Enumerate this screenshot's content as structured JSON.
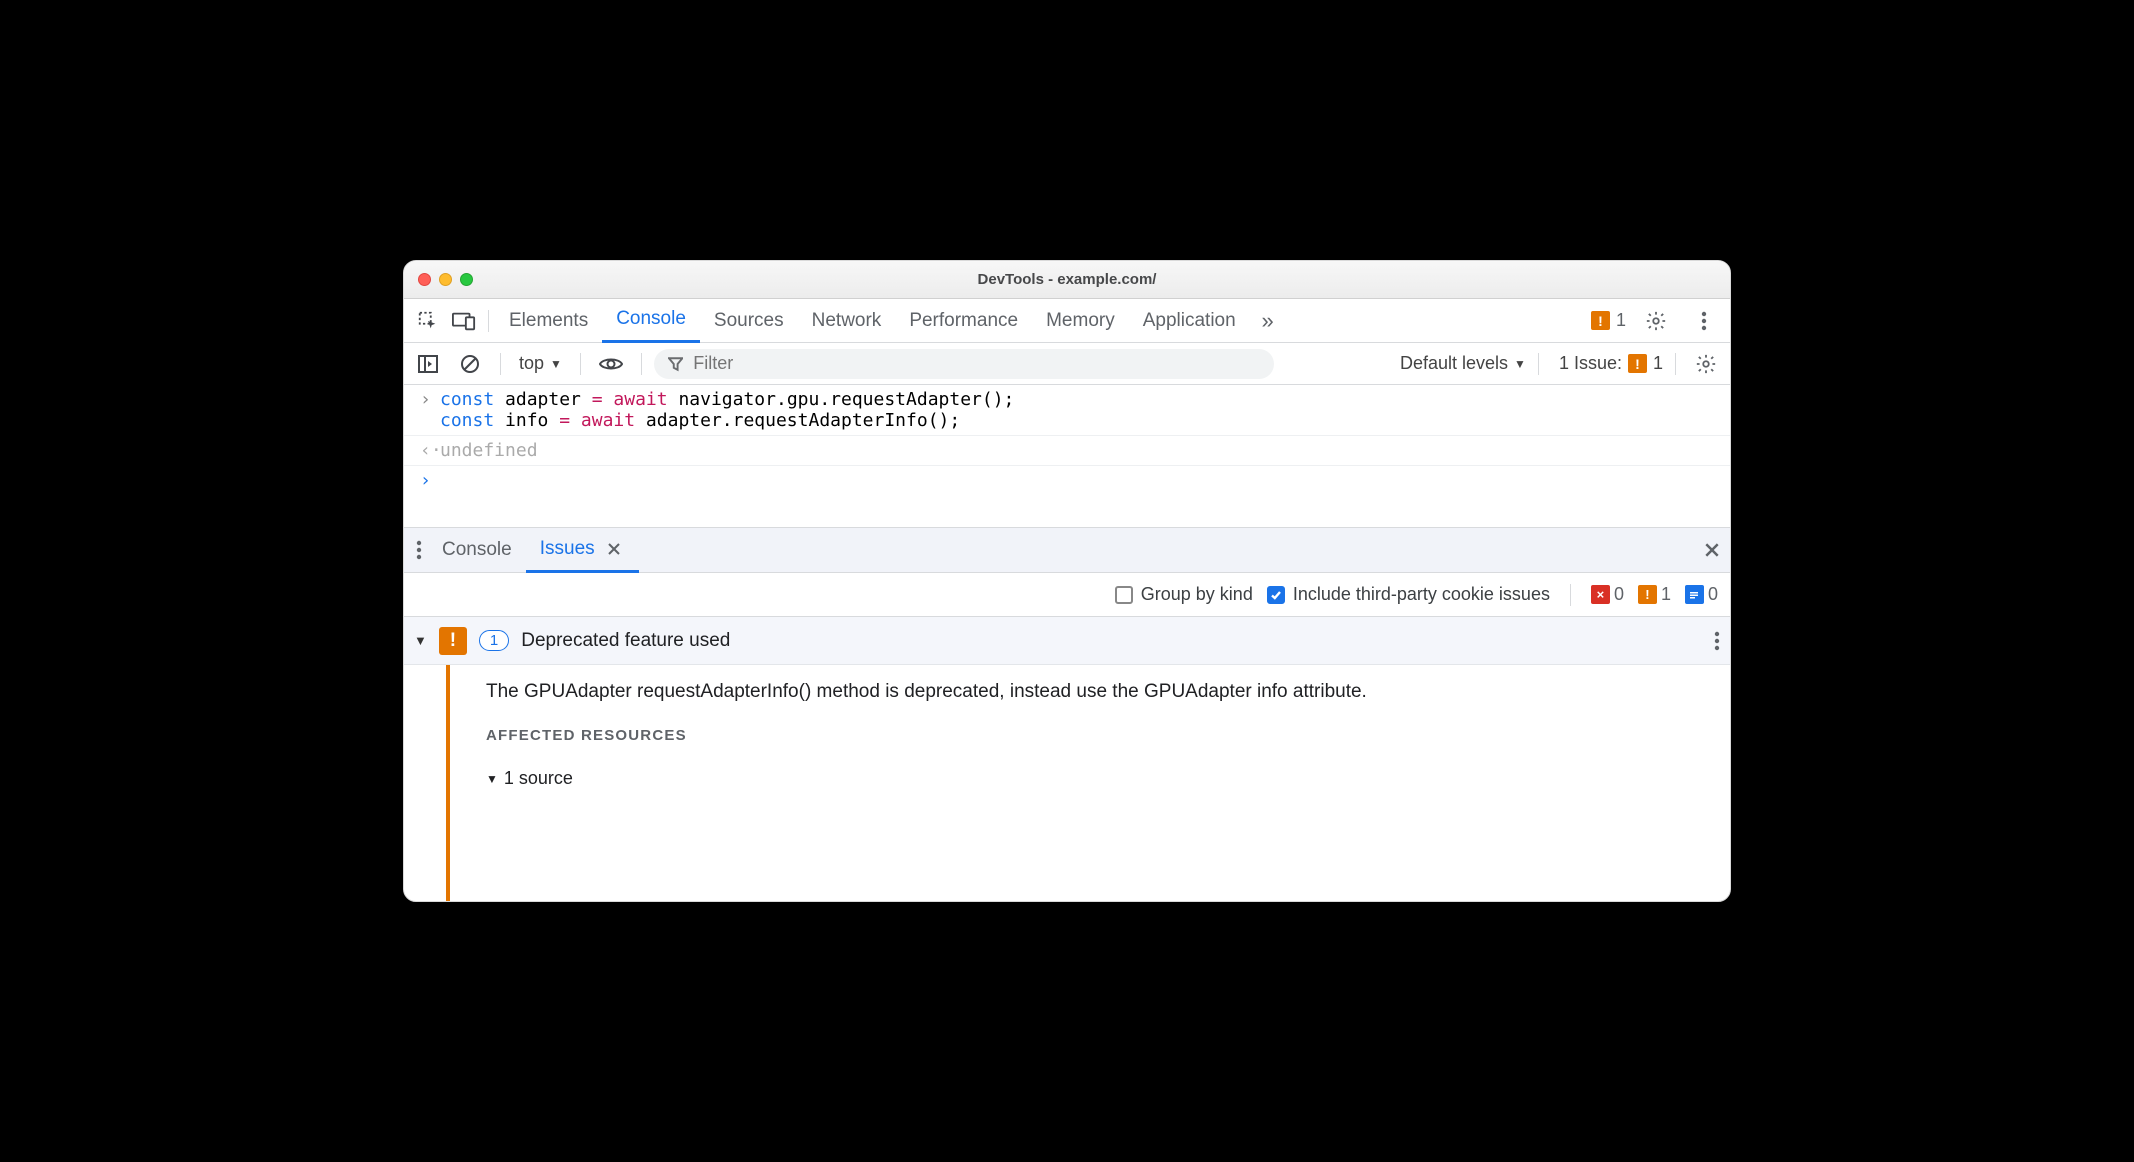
{
  "window": {
    "title": "DevTools - example.com/"
  },
  "tabs": {
    "items": [
      "Elements",
      "Console",
      "Sources",
      "Network",
      "Performance",
      "Memory",
      "Application"
    ],
    "active": "Console",
    "overflow_count": 1
  },
  "console_controls": {
    "context": "top",
    "filter_placeholder": "Filter",
    "levels": "Default levels",
    "issues_link_label": "1 Issue:",
    "issues_link_count": 1
  },
  "console": {
    "input_line1": "const adapter = await navigator.gpu.requestAdapter();",
    "input_line2": "const info = await adapter.requestAdapterInfo();",
    "result": "undefined"
  },
  "drawer_tabs": {
    "items": [
      "Console",
      "Issues"
    ],
    "active": "Issues"
  },
  "issues_filter": {
    "group_by_kind_label": "Group by kind",
    "group_by_kind_checked": false,
    "include_tp_label": "Include third-party cookie issues",
    "include_tp_checked": true,
    "counts": {
      "errors": 0,
      "warnings": 1,
      "info": 0
    }
  },
  "issue": {
    "count": 1,
    "title": "Deprecated feature used",
    "detail": "The GPUAdapter requestAdapterInfo() method is deprecated, instead use the GPUAdapter info attribute.",
    "affected_header": "AFFECTED RESOURCES",
    "sources_summary": "1 source"
  }
}
